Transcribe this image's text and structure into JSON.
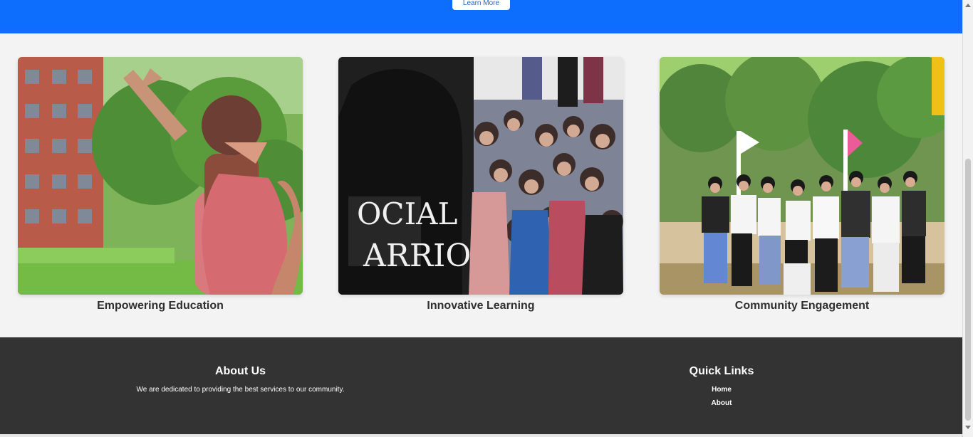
{
  "hero": {
    "button_label": "Learn More",
    "background_color": "#0d6efd"
  },
  "cards": [
    {
      "title": "Empowering Education",
      "image_icon": "photo"
    },
    {
      "title": "Innovative Learning",
      "image_icon": "photo"
    },
    {
      "title": "Community Engagement",
      "image_icon": "photo"
    }
  ],
  "footer": {
    "about_title": "About Us",
    "about_text": "We are dedicated to providing the best services to our community.",
    "quick_links_title": "Quick Links",
    "quick_links": [
      "Home",
      "About"
    ],
    "background_color": "#333333"
  },
  "scrollbar": {
    "up_icon": "arrow-up-icon",
    "down_icon": "arrow-down-icon"
  }
}
